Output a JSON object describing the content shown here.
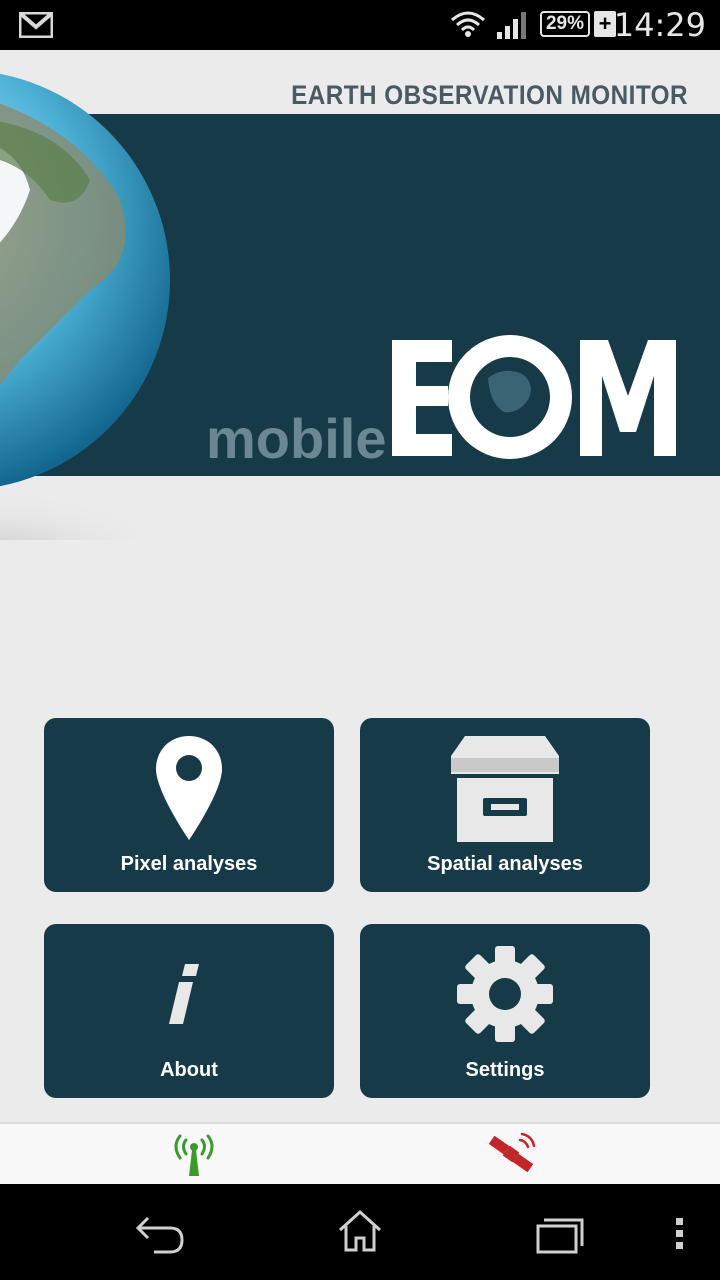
{
  "status_bar": {
    "time": "14:29",
    "battery_percent": "29%",
    "charging_symbol": "+",
    "icons": [
      "gmail-icon",
      "wifi-icon",
      "signal-icon",
      "battery-icon"
    ]
  },
  "app": {
    "header_title": "EARTH OBSERVATION MONITOR",
    "logo_text_small": "mobile",
    "logo_text_large": "EOM",
    "colors": {
      "primary": "#173a48",
      "background": "#ebebeb",
      "header_text": "#4a5a63",
      "tab_green": "#3a9a2a",
      "tab_red": "#c0262a"
    }
  },
  "tiles": [
    {
      "label": "Pixel analyses",
      "icon": "map-pin-icon"
    },
    {
      "label": "Spatial analyses",
      "icon": "archive-box-icon"
    },
    {
      "label": "About",
      "icon": "info-icon"
    },
    {
      "label": "Settings",
      "icon": "gear-icon"
    }
  ],
  "bottom_tabs": [
    {
      "icon": "antenna-icon"
    },
    {
      "icon": "satellite-icon"
    }
  ],
  "nav_bar": {
    "icons": [
      "back-icon",
      "home-icon",
      "recents-icon",
      "overflow-menu-icon"
    ]
  }
}
